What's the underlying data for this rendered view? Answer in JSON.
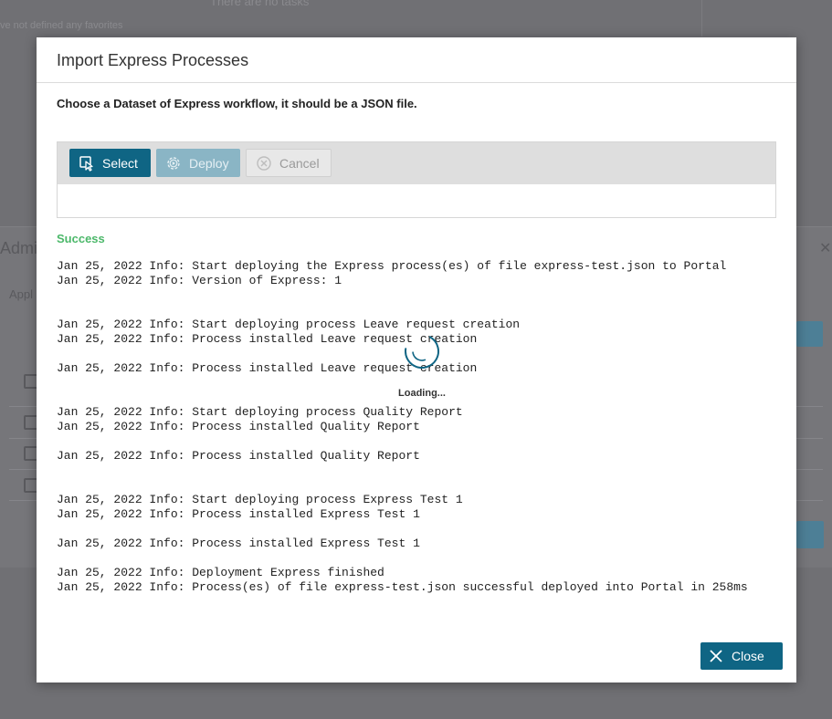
{
  "background": {
    "tasks_text": "There are no tasks",
    "favorites_text": "ve not defined any favorites",
    "admin_title": "Admi",
    "admin_tab": "Appl"
  },
  "dialog": {
    "title": "Import Express Processes",
    "instruction": "Choose a Dataset of Express workflow, it should be a JSON file.",
    "buttons": {
      "select": "Select",
      "deploy": "Deploy",
      "cancel": "Cancel",
      "close": "Close"
    },
    "status": "Success",
    "loading_label": "Loading...",
    "log_lines": [
      "Jan 25, 2022 Info: Start deploying the Express process(es) of file express-test.json to Portal",
      "Jan 25, 2022 Info: Version of Express: 1",
      "",
      "",
      "Jan 25, 2022 Info: Start deploying process Leave request creation",
      "Jan 25, 2022 Info: Process installed Leave request creation",
      "",
      "Jan 25, 2022 Info: Process installed Leave request creation",
      "",
      "",
      "Jan 25, 2022 Info: Start deploying process Quality Report",
      "Jan 25, 2022 Info: Process installed Quality Report",
      "",
      "Jan 25, 2022 Info: Process installed Quality Report",
      "",
      "",
      "Jan 25, 2022 Info: Start deploying process Express Test 1",
      "Jan 25, 2022 Info: Process installed Express Test 1",
      "",
      "Jan 25, 2022 Info: Process installed Express Test 1",
      "",
      "Jan 25, 2022 Info: Deployment Express finished",
      "Jan 25, 2022 Info: Process(es) of file express-test.json successful deployed into Portal in 258ms"
    ]
  },
  "colors": {
    "primary": "#0f6584",
    "success": "#4cb86a",
    "overlay": "#707074"
  }
}
